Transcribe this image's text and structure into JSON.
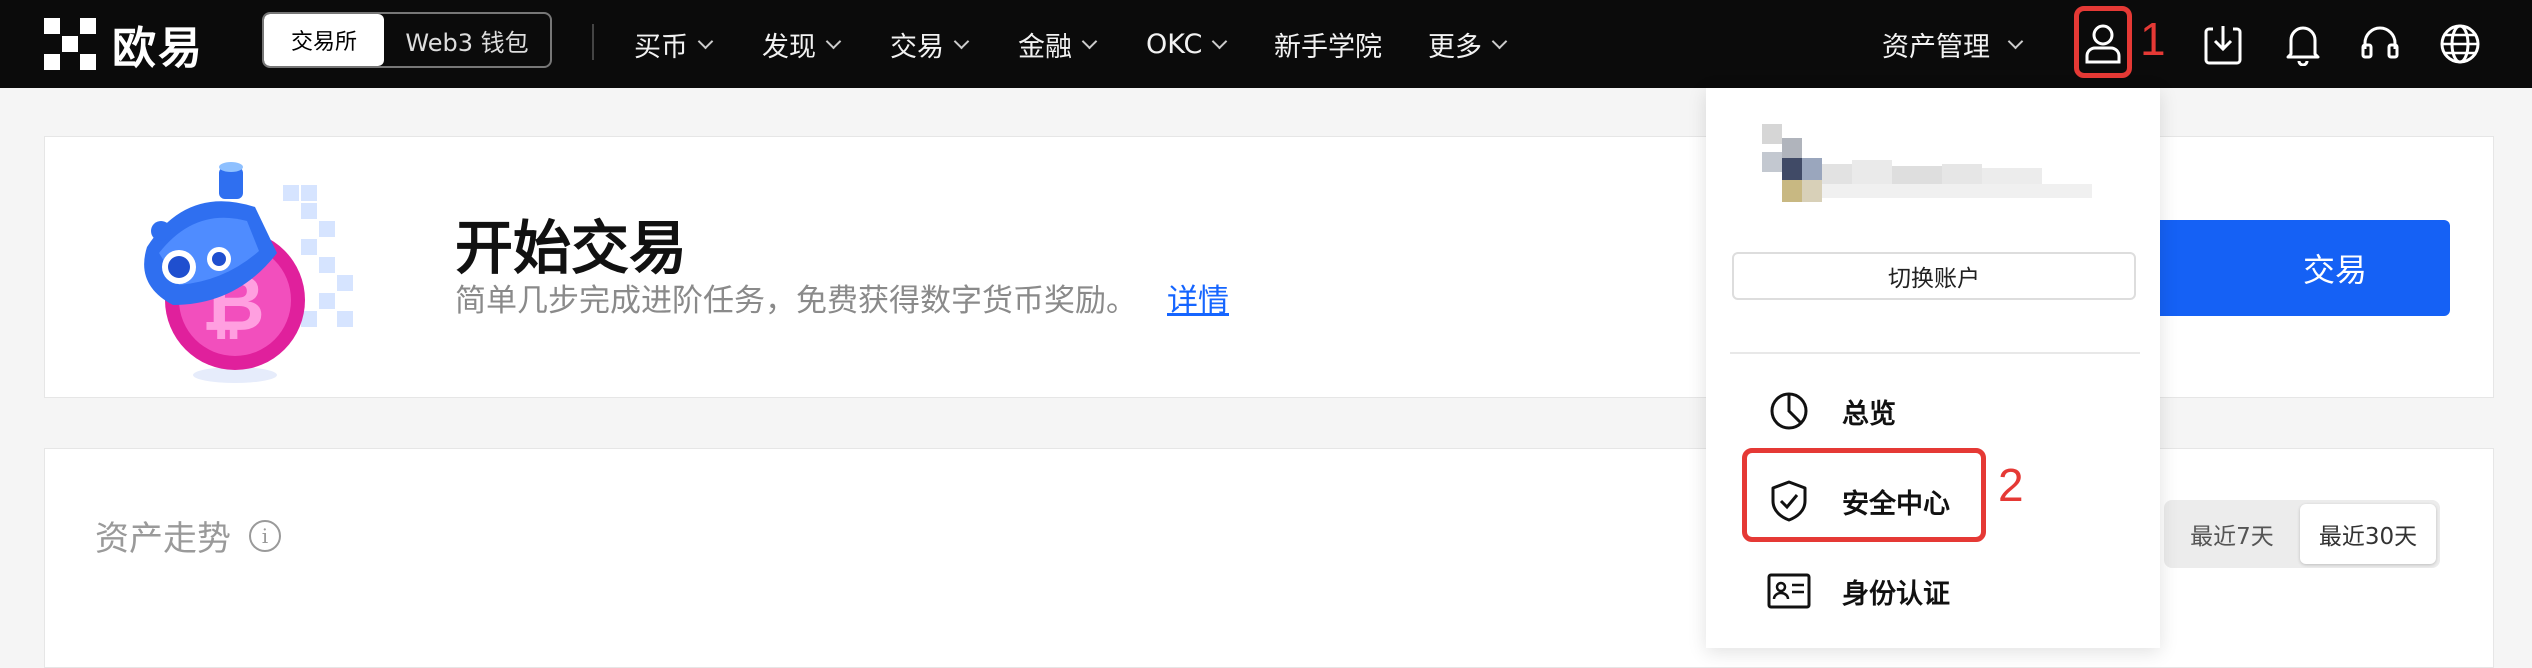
{
  "brand": {
    "name": "欧易"
  },
  "header": {
    "segment": {
      "active": "交易所",
      "inactive": "Web3 钱包"
    },
    "nav": [
      {
        "label": "买币"
      },
      {
        "label": "发现"
      },
      {
        "label": "交易"
      },
      {
        "label": "金融"
      },
      {
        "label": "OKC"
      },
      {
        "label": "新手学院"
      },
      {
        "label": "更多"
      }
    ],
    "asset_management": "资产管理",
    "icons": [
      "user-icon",
      "download-icon",
      "bell-icon",
      "headset-icon",
      "globe-icon"
    ]
  },
  "annotations": {
    "step1": "1",
    "step2": "2",
    "highlight_color": "#e53935"
  },
  "promo": {
    "title": "开始交易",
    "subtitle": "简单几步完成进阶任务，免费获得数字货币奖励。",
    "link": "详情",
    "button": "交易"
  },
  "assets": {
    "title": "资产走势",
    "info": "i",
    "range_options": [
      "最近7天",
      "最近30天"
    ],
    "selected_range": "最近30天"
  },
  "account_menu": {
    "switch_label": "切换账户",
    "items": [
      {
        "label": "总览",
        "icon": "pie-chart-icon"
      },
      {
        "label": "安全中心",
        "icon": "shield-check-icon"
      },
      {
        "label": "身份认证",
        "icon": "id-card-icon"
      }
    ]
  },
  "colors": {
    "accent": "#1561f5",
    "topbar": "#0b0b0b",
    "link": "#1565ff"
  }
}
